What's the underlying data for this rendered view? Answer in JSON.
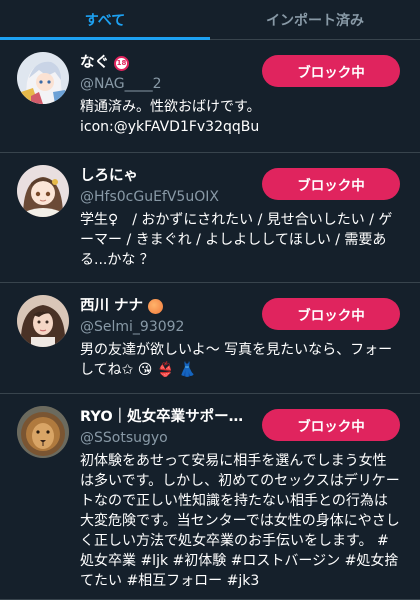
{
  "tabs": [
    {
      "label": "すべて",
      "active": true
    },
    {
      "label": "インポート済み",
      "active": false
    }
  ],
  "accounts": [
    {
      "name": "なぐ",
      "name_badge": "18",
      "handle": "@NAG____2",
      "bio": "精通済み。性欲おばけです。\nicon:@ykFAVD1Fv32qqBu",
      "button": "ブロック中",
      "avatar_icon": "anime-girl-avatar"
    },
    {
      "name": "しろにゃ",
      "handle": "@Hfs0cGuEfV5uOIX",
      "bio": "学生♀　/ おかずにされたい / 見せ合いしたい / ゲーマー / きまぐれ / よしよししてほしい / 需要ある...かな ？",
      "button": "ブロック中",
      "avatar_icon": "anime-girl-avatar"
    },
    {
      "name": "西川 ナナ",
      "name_emoji": "peach",
      "handle": "@Selmi_93092",
      "bio": "男の友達が欲しいよ〜 写真を見たいなら、フォーしてね✩ 😘 👙 👗",
      "button": "ブロック中",
      "avatar_icon": "woman-photo-avatar"
    },
    {
      "name": "RYO｜処女卒業サポー…",
      "handle": "@SSotsugyo",
      "bio": "初体験をあせって安易に相手を選んでしまう女性は多いです。しかし、初めてのセックスはデリケートなので正しい性知識を持たない相手との行為は大変危険です。当センターでは女性の身体にやさしく正しい方法で処女卒業のお手伝いをします。 #処女卒業 #ljk #初体験 #ロストバージン #処女捨てたい #相互フォロー #jk3",
      "button": "ブロック中",
      "avatar_icon": "lion-avatar"
    }
  ],
  "colors": {
    "background": "#15202b",
    "accent": "#1da1f2",
    "block_button": "#e0245e",
    "secondary_text": "#8899a6",
    "divider": "#38444d"
  }
}
